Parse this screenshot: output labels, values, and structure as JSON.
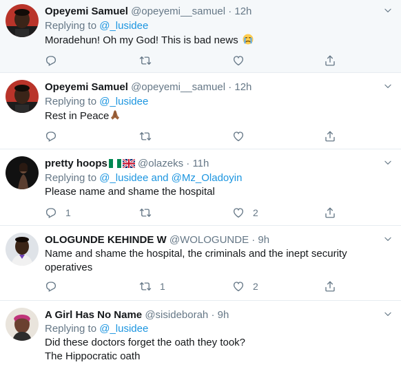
{
  "tweets": [
    {
      "name": "Opeyemi Samuel",
      "handle": "@opeyemi__samuel",
      "separator": "·",
      "time": "12h",
      "replying_prefix": "Replying to",
      "reply_to": "@_lusidee",
      "text": "Moradehun! Oh my God! This is bad news",
      "emoji": "crying-face-icon"
    },
    {
      "name": "Opeyemi Samuel",
      "handle": "@opeyemi__samuel",
      "separator": "·",
      "time": "12h",
      "replying_prefix": "Replying to",
      "reply_to": "@_lusidee",
      "text": "Rest in Peace",
      "emoji": "folded-hands-icon"
    },
    {
      "name": "pretty hoops",
      "handle": "@olazeks",
      "separator": "·",
      "time": "11h",
      "replying_prefix": "Replying to",
      "reply_to": "@_lusidee and @Mz_Oladoyin",
      "text": "Please name and shame the hospital",
      "reply_count": "1",
      "like_count": "2",
      "flags": [
        "nigeria-flag-icon",
        "uk-flag-icon"
      ]
    },
    {
      "name": "OLOGUNDE KEHINDE W",
      "handle": "@WOLOGUNDE",
      "separator": "·",
      "time": "9h",
      "text": "Name and shame the hospital, the criminals and the inept security operatives",
      "retweet_count": "1",
      "like_count": "2"
    },
    {
      "name": "A Girl Has No Name",
      "handle": "@sisideborah",
      "separator": "·",
      "time": "9h",
      "replying_prefix": "Replying to",
      "reply_to": "@_lusidee",
      "text_line1": "Did these doctors forget the oath they took?",
      "text_line2": "The Hippocratic oath"
    }
  ],
  "colors": {
    "link": "#1b95e0",
    "secondary": "#657786",
    "highlight_bg": "#f5f8fa",
    "border": "#e6ecf0"
  }
}
